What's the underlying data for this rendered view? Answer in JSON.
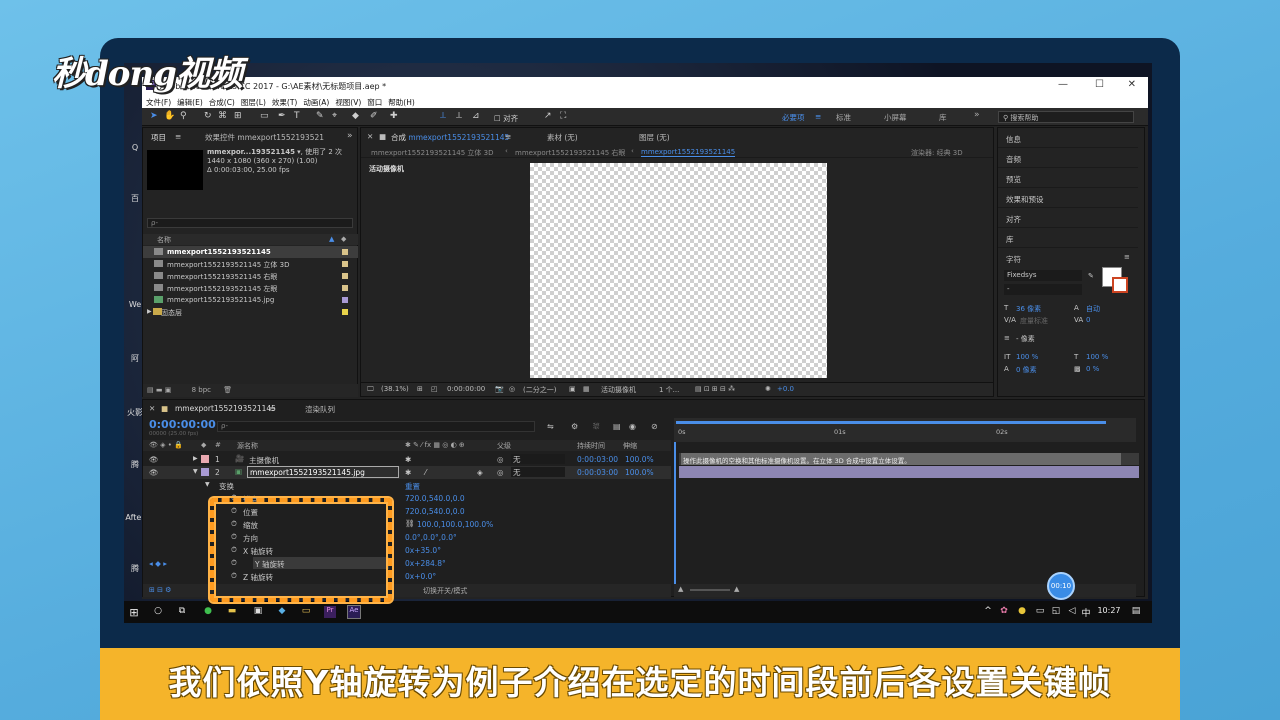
{
  "logo": "秒dong视频",
  "desktop_icons": [
    "Q",
    "百",
    "W",
    "We",
    "阿",
    "火影",
    "腾",
    "After",
    "腾"
  ],
  "window": {
    "title": "Adobe After Effects CC 2017 - G:\\AE素材\\无标题项目.aep *",
    "min": "—",
    "max": "☐",
    "close": "✕"
  },
  "menu": [
    "文件(F)",
    "编辑(E)",
    "合成(C)",
    "图层(L)",
    "效果(T)",
    "动画(A)",
    "视图(V)",
    "窗口",
    "帮助(H)"
  ],
  "toolbar": {
    "align_label": "对齐",
    "workspaces": [
      "必要项",
      "标准",
      "小屏幕",
      "库"
    ],
    "search_help": "搜索帮助"
  },
  "project": {
    "tab_project": "项目",
    "tab_effects": "效果控件 mmexport1552193521",
    "item_name": "mmexpor...193521145",
    "used": "▾, 使用了 2 次",
    "dims": "1440 x 1080  (360 x 270) (1.00)",
    "duration": "Δ 0:00:03:00, 25.00 fps",
    "search_placeholder": "ρ-",
    "col_name": "名称",
    "items": [
      {
        "name": "mmexport1552193521145",
        "color": "#d9c38a"
      },
      {
        "name": "mmexport1552193521145 立体 3D",
        "color": "#d9c38a"
      },
      {
        "name": "mmexport1552193521145 右眼",
        "color": "#d9c38a"
      },
      {
        "name": "mmexport1552193521145 左眼",
        "color": "#d9c38a"
      },
      {
        "name": "mmexport1552193521145.jpg",
        "color": "#a99ad4"
      },
      {
        "name": "固态层",
        "color": "#e8d34a"
      }
    ],
    "bpc": "8 bpc"
  },
  "composition": {
    "tab_comp": "合成",
    "tab_comp_name": "mmexport1552193521145",
    "tab_footage": "素材  (无)",
    "tab_layer": "图层  (无)",
    "crumbs": [
      "mmexport1552193521145 立体 3D",
      "mmexport1552193521145 右眼",
      "mmexport1552193521145"
    ],
    "renderer": "渲染器:  经典 3D",
    "camera_label": "活动摄像机",
    "zoom": "(38.1%)",
    "timecode": "0:00:00:00",
    "resolution": "(二分之一)",
    "view": "活动摄像机",
    "views_count": "1 个...",
    "exposure": "+0.0"
  },
  "right_panels": [
    "信息",
    "音频",
    "预览",
    "效果和预设",
    "对齐",
    "库"
  ],
  "character": {
    "title": "字符",
    "font": "Fixedsys",
    "style": "-",
    "size": "36 像素",
    "leading": "自动",
    "kerning": "度量标准",
    "tracking": "0",
    "stroke": "- 像素",
    "vscale": "100 %",
    "hscale": "100 %",
    "baseline": "0 像素",
    "tsume": "0 %"
  },
  "timeline": {
    "tab_name": "mmexport1552193521145",
    "tab_render": "渲染队列",
    "timecode": "0:00:00:00",
    "fps": "00000 (25.00 fps)",
    "search": "ρ-",
    "headers": {
      "num": "#",
      "source": "源名称",
      "parent": "父级",
      "duration": "持续时间",
      "stretch": "伸缩"
    },
    "layers": [
      {
        "num": "1",
        "name": "主摄像机",
        "parent": "无",
        "duration": "0:00:03:00",
        "stretch": "100.0%",
        "color": "#e9a8b0"
      },
      {
        "num": "2",
        "name": "mmexport1552193521145.jpg",
        "parent": "无",
        "duration": "0:00:03:00",
        "stretch": "100.0%",
        "color": "#a99ad4"
      }
    ],
    "transform": "变换",
    "reset": "重置",
    "props": [
      {
        "name": "锚点",
        "value": "720.0,540.0,0.0"
      },
      {
        "name": "位置",
        "value": "720.0,540.0,0.0"
      },
      {
        "name": "缩放",
        "value": "100.0,100.0,100.0%"
      },
      {
        "name": "方向",
        "value": "0.0°,0.0°,0.0°"
      },
      {
        "name": "X 轴旋转",
        "value": "0x+35.0°"
      },
      {
        "name": "Y 轴旋转",
        "value": "0x+284.8°"
      },
      {
        "name": "Z 轴旋转",
        "value": "0x+0.0°"
      }
    ],
    "toggle_label": "切换开关/模式",
    "ruler": [
      "0s",
      "01s",
      "02s"
    ],
    "tooltip": "操作此摄像机的空换和其他标准摄像机设置。在立体 3D 合成中设置立体设置。",
    "circle_time": "00:10"
  },
  "taskbar": {
    "time": "10:27",
    "ime": "中"
  },
  "caption": "我们依照Y轴旋转为例子介绍在选定的时间段前后各设置关键帧"
}
